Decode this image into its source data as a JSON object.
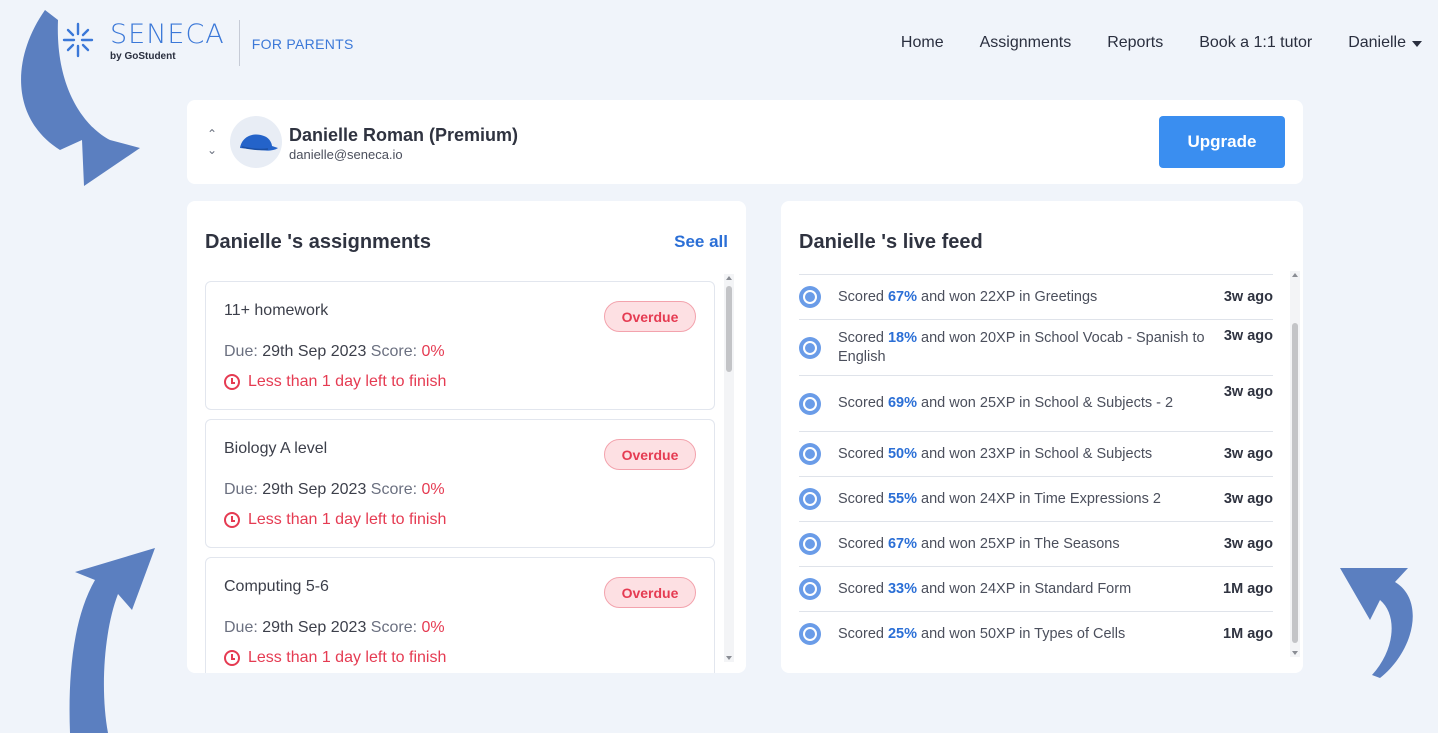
{
  "header": {
    "logo_word": "SENECA",
    "logo_by": "by GoStudent",
    "logo_section": "FOR PARENTS",
    "nav": [
      "Home",
      "Assignments",
      "Reports",
      "Book a 1:1 tutor"
    ],
    "user_menu": "Danielle"
  },
  "student": {
    "name": "Danielle Roman (Premium)",
    "email": "danielle@seneca.io",
    "upgrade_label": "Upgrade"
  },
  "assignments": {
    "title": "Danielle 's assignments",
    "see_all": "See all",
    "due_label": "Due:",
    "score_label": "Score:",
    "items": [
      {
        "title": "11+ homework",
        "status": "Overdue",
        "due": "29th Sep 2023",
        "score": "0%",
        "time_left": "Less than 1 day left to finish"
      },
      {
        "title": "Biology A level",
        "status": "Overdue",
        "due": "29th Sep 2023",
        "score": "0%",
        "time_left": "Less than 1 day left to finish"
      },
      {
        "title": "Computing 5-6",
        "status": "Overdue",
        "due": "29th Sep 2023",
        "score": "0%",
        "time_left": "Less than 1 day left to finish"
      }
    ]
  },
  "feed": {
    "title": "Danielle 's live feed",
    "items": [
      {
        "prefix": "Scored ",
        "pct": "67%",
        "rest": " and won 22XP in Greetings",
        "time": "3w ago"
      },
      {
        "prefix": "Scored ",
        "pct": "18%",
        "rest": " and won 20XP in School Vocab - Spanish to English",
        "time": "3w ago"
      },
      {
        "prefix": "Scored ",
        "pct": "69%",
        "rest": " and won 25XP in School & Subjects - 2",
        "time": "3w ago"
      },
      {
        "prefix": "Scored ",
        "pct": "50%",
        "rest": " and won 23XP in School & Subjects",
        "time": "3w ago"
      },
      {
        "prefix": "Scored ",
        "pct": "55%",
        "rest": " and won 24XP in Time Expressions 2",
        "time": "3w ago"
      },
      {
        "prefix": "Scored ",
        "pct": "67%",
        "rest": " and won 25XP in The Seasons",
        "time": "3w ago"
      },
      {
        "prefix": "Scored ",
        "pct": "33%",
        "rest": " and won 24XP in Standard Form",
        "time": "1M ago"
      },
      {
        "prefix": "Scored ",
        "pct": "25%",
        "rest": " and won 50XP in Types of Cells",
        "time": "1M ago"
      }
    ]
  },
  "colors": {
    "accent": "#3a8ef0",
    "link": "#2b6fd6",
    "overdue": "#e53b52",
    "arrow": "#5b7fc0",
    "background": "#f0f4fa"
  },
  "icons": [
    "seneca-logo-icon",
    "gostudent-icon",
    "caret-down-icon",
    "chevron-up-icon",
    "chevron-down-icon",
    "cap-avatar-icon",
    "clock-icon",
    "target-icon",
    "curved-arrow-icon"
  ]
}
